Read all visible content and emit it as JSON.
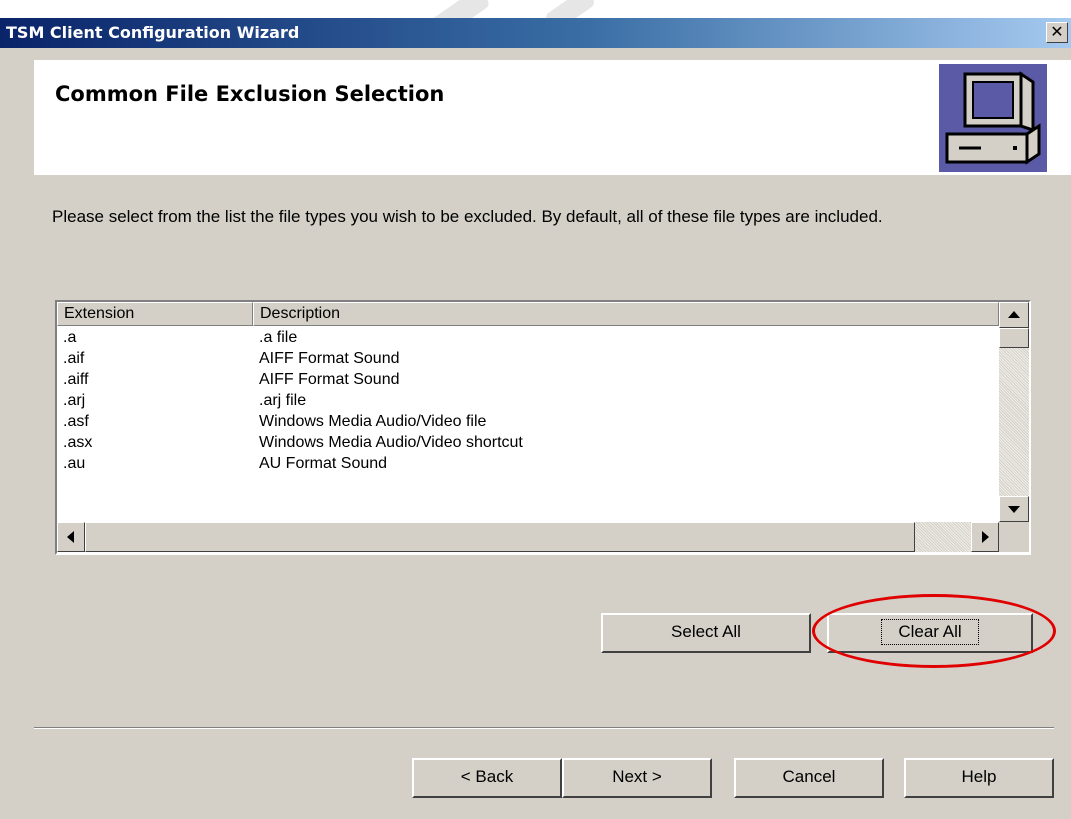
{
  "window": {
    "title": "TSM Client Configuration Wizard",
    "close_glyph": "✕"
  },
  "header": {
    "heading": "Common File Exclusion Selection",
    "icon": "computer-icon"
  },
  "instruction": "Please select from the list the file types you wish to be excluded. By default, all of these file types are included.",
  "list": {
    "columns": [
      "Extension",
      "Description"
    ],
    "rows": [
      {
        "ext": ".a",
        "desc": ".a file"
      },
      {
        "ext": ".aif",
        "desc": "AIFF Format Sound"
      },
      {
        "ext": ".aiff",
        "desc": "AIFF Format Sound"
      },
      {
        "ext": ".arj",
        "desc": ".arj file"
      },
      {
        "ext": ".asf",
        "desc": "Windows Media Audio/Video file"
      },
      {
        "ext": ".asx",
        "desc": "Windows Media Audio/Video shortcut"
      },
      {
        "ext": ".au",
        "desc": "AU Format Sound"
      }
    ]
  },
  "actions": {
    "select_all": "Select All",
    "clear_all": "Clear All"
  },
  "nav": {
    "back": "< Back",
    "next": "Next >",
    "cancel": "Cancel",
    "help": "Help"
  },
  "colors": {
    "accent_highlight": "#e00000",
    "title_start": "#0a246a",
    "dialog_bg": "#d4d0c8"
  }
}
